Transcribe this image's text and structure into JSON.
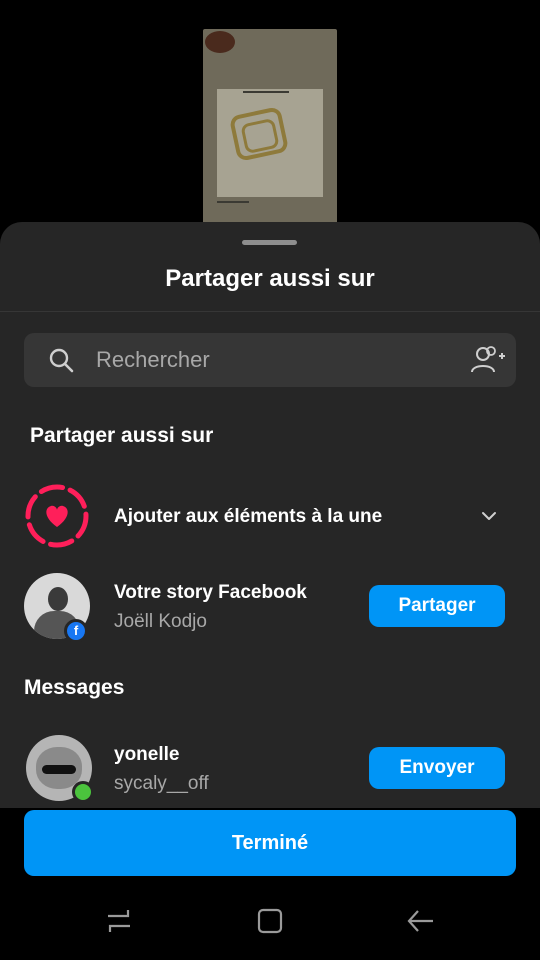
{
  "sheet": {
    "title": "Partager aussi sur"
  },
  "search": {
    "placeholder": "Rechercher",
    "search_icon": "search-icon",
    "add_people_icon": "add-people-icon"
  },
  "share_section": {
    "heading": "Partager aussi sur",
    "highlights": {
      "label": "Ajouter aux éléments à la une",
      "icon": "heart-ring-icon",
      "chevron_icon": "chevron-down-icon"
    },
    "facebook_story": {
      "title": "Votre story Facebook",
      "subtitle": "Joëll Kodjo",
      "button_label": "Partager",
      "badge_icon": "facebook-icon"
    }
  },
  "messages_section": {
    "heading": "Messages",
    "contacts": [
      {
        "name": "yonelle",
        "username": "sycaly__off",
        "button_label": "Envoyer",
        "online": true
      }
    ]
  },
  "footer": {
    "done_label": "Terminé"
  },
  "nav": {
    "recents_icon": "recents-icon",
    "home_icon": "home-icon",
    "back_icon": "back-arrow-icon"
  },
  "colors": {
    "sheet_bg": "#262626",
    "accent": "#0095f6",
    "highlight_pink": "#ff1f5a",
    "online_green": "#4bc33d",
    "facebook_blue": "#1877f2"
  }
}
